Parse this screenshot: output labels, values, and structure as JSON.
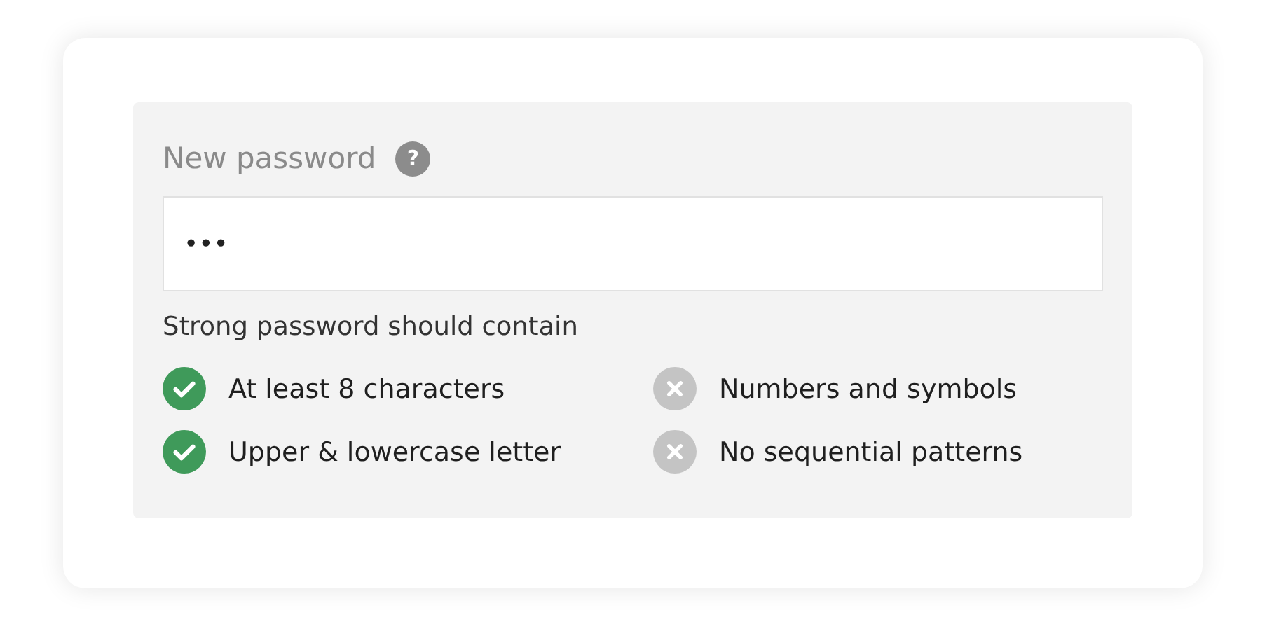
{
  "field": {
    "label": "New password",
    "help": "?",
    "value": "•••"
  },
  "requirements_title": "Strong password should contain",
  "requirements": [
    {
      "text": "At least 8 characters",
      "checked": true
    },
    {
      "text": "Numbers and symbols",
      "checked": false
    },
    {
      "text": "Upper & lowercase letter",
      "checked": true
    },
    {
      "text": "No sequential patterns",
      "checked": false
    }
  ]
}
